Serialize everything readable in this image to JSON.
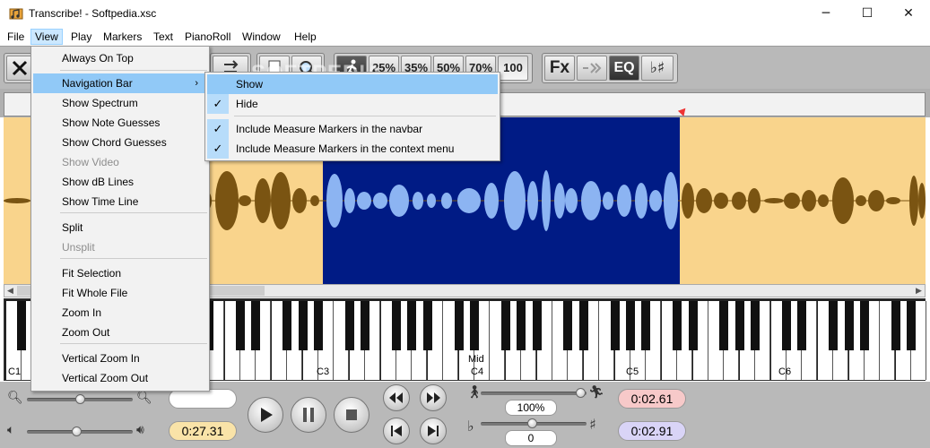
{
  "window": {
    "title": "Transcribe! - Softpedia.xsc",
    "minimize": "─",
    "maximize": "☐",
    "close": "✕"
  },
  "menubar": {
    "items": [
      "File",
      "View",
      "Play",
      "Markers",
      "Text",
      "PianoRoll",
      "Window",
      "Help"
    ],
    "active": "View"
  },
  "toolbar": {
    "speed_buttons": [
      "25%",
      "35%",
      "50%",
      "70%",
      "100"
    ],
    "fx": "Fx",
    "eq": "EQ",
    "accidentals": "♭♯"
  },
  "view_menu": {
    "items": [
      {
        "label": "Always On Top",
        "disabled": false
      },
      {
        "label": "Navigation Bar",
        "disabled": false,
        "submenu": true,
        "highlight": true
      },
      {
        "label": "Show Spectrum",
        "disabled": false
      },
      {
        "label": "Show Note Guesses",
        "disabled": false
      },
      {
        "label": "Show Chord Guesses",
        "disabled": false
      },
      {
        "label": "Show Video",
        "disabled": true
      },
      {
        "label": "Show dB Lines",
        "disabled": false
      },
      {
        "label": "Show Time Line",
        "disabled": false
      },
      {
        "label": "Split",
        "disabled": false
      },
      {
        "label": "Unsplit",
        "disabled": true
      },
      {
        "label": "Fit Selection",
        "disabled": false
      },
      {
        "label": "Fit Whole File",
        "disabled": false
      },
      {
        "label": "Zoom In",
        "disabled": false
      },
      {
        "label": "Zoom Out",
        "disabled": false
      },
      {
        "label": "Vertical Zoom In",
        "disabled": false
      },
      {
        "label": "Vertical Zoom Out",
        "disabled": false
      }
    ],
    "submenu_arrow": "›"
  },
  "nav_submenu": {
    "items": [
      {
        "label": "Show",
        "checked": false,
        "highlight": true
      },
      {
        "label": "Hide",
        "checked": true
      },
      {
        "label": "Include Measure Markers in the navbar",
        "checked": true
      },
      {
        "label": "Include Measure Markers in the context menu",
        "checked": true
      }
    ],
    "check": "✓"
  },
  "piano": {
    "labels": [
      "C1",
      "C3",
      "C4",
      "C5",
      "C6"
    ],
    "middle_label": "Mid"
  },
  "controls": {
    "position_time": "0:27.31",
    "speed": "100%",
    "transpose": "0",
    "selection_start": "0:02.61",
    "selection_end": "0:02.91",
    "blank_field": ""
  },
  "watermark": "SOFTPEDIA",
  "colors": {
    "waveform_bg": "#f9d48c",
    "selection_bg": "#001b85",
    "wave_fg": "#7a5412",
    "wave_sel_fg": "#8cb4f2",
    "start_pill": "#f7c9c9",
    "end_pill": "#d9d4f7",
    "position_pill": "#f9e3a8"
  }
}
